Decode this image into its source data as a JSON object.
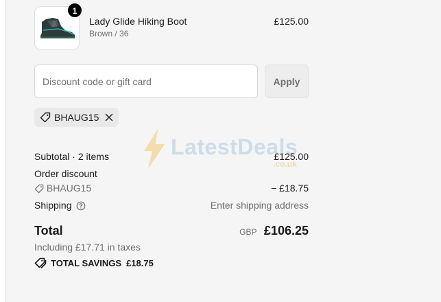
{
  "product": {
    "name": "Lady Glide Hiking Boot",
    "variant": "Brown / 36",
    "price": "£125.00",
    "quantity": "1",
    "image_icon": "hiking-boot-image"
  },
  "discount": {
    "placeholder": "Discount code or gift card",
    "value": "",
    "apply_label": "Apply",
    "applied_code": "BHAUG15"
  },
  "watermark": {
    "text": "LatestDeals",
    "sub": ".co.uk"
  },
  "summary": {
    "subtotal_label": "Subtotal · 2 items",
    "subtotal_value": "£125.00",
    "order_discount_label": "Order discount",
    "discount_code": "BHAUG15",
    "discount_value": "− £18.75",
    "shipping_label": "Shipping",
    "shipping_value": "Enter shipping address",
    "total_label": "Total",
    "currency": "GBP",
    "total_value": "£106.25",
    "taxes_note": "Including £17.71 in taxes",
    "savings_label": "TOTAL SAVINGS",
    "savings_value": "£18.75"
  },
  "colors": {
    "background": "#f5f5f5",
    "muted_text": "#707070",
    "chip_bg": "#e9e9e9"
  }
}
